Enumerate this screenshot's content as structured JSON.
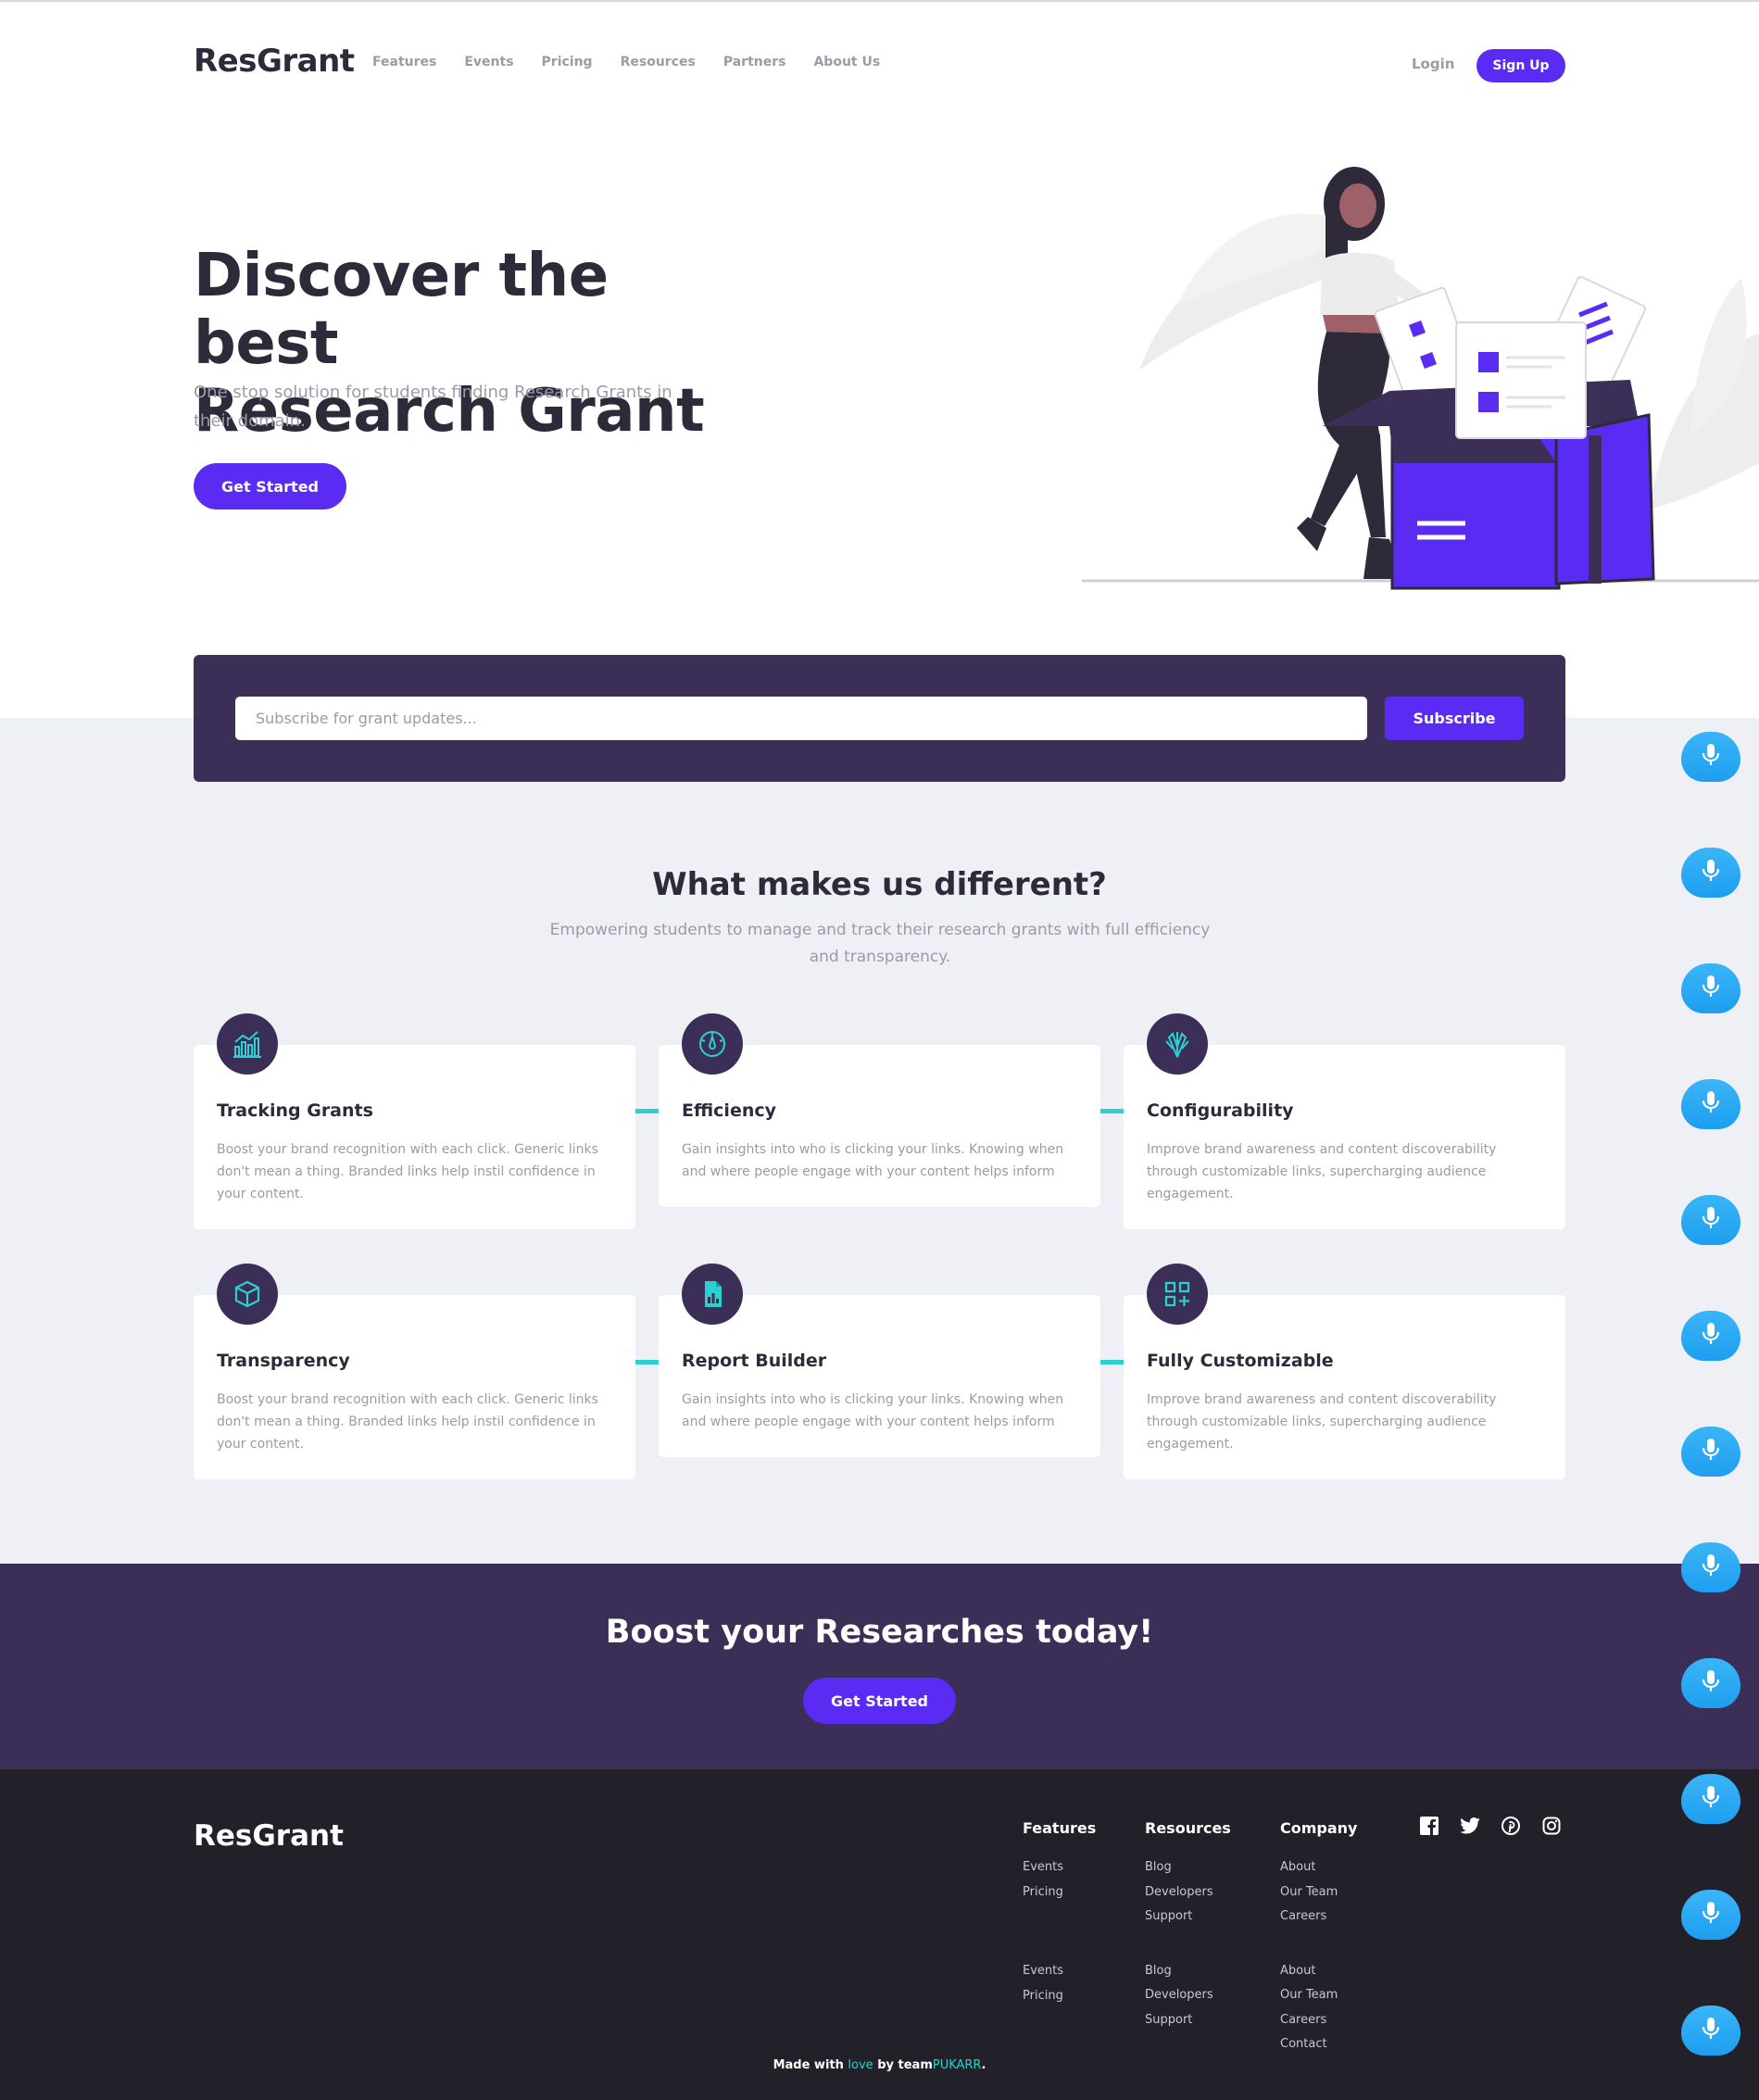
{
  "header": {
    "logo": "ResGrant",
    "nav": [
      "Features",
      "Events",
      "Pricing",
      "Resources",
      "Partners",
      "About Us"
    ],
    "login": "Login",
    "signup": "Sign Up"
  },
  "hero": {
    "title_line1": "Discover the best",
    "title_line2": "Research Grant",
    "subtitle": "One stop solution for students finding Research Grants in their domain.",
    "cta": "Get Started"
  },
  "subscribe": {
    "placeholder": "Subscribe for grant updates...",
    "button": "Subscribe"
  },
  "features": {
    "title": "What makes us different?",
    "subtitle": "Empowering students to manage and track their research grants with full efficiency and transparency.",
    "cards": [
      {
        "title": "Tracking Grants",
        "text": "Boost your brand recognition with each click. Generic links don't mean a thing. Branded links help instil confidence in your content.",
        "icon": "chart-bars-icon"
      },
      {
        "title": "Efficiency",
        "text": "Gain insights into who is clicking your links. Knowing when and where people engage with your content helps inform",
        "icon": "gauge-icon"
      },
      {
        "title": "Configurability",
        "text": "Improve brand awareness and content discoverability through customizable links, supercharging audience engagement.",
        "icon": "tools-icon"
      },
      {
        "title": "Transparency",
        "text": "Boost your brand recognition with each click. Generic links don't mean a thing. Branded links help instil confidence in your content.",
        "icon": "cube-icon"
      },
      {
        "title": "Report Builder",
        "text": "Gain insights into who is clicking your links. Knowing when and where people engage with your content helps inform",
        "icon": "report-file-icon"
      },
      {
        "title": "Fully Customizable",
        "text": "Improve brand awareness and content discoverability through customizable links, supercharging audience engagement.",
        "icon": "grid-add-icon"
      }
    ]
  },
  "cta": {
    "title": "Boost your Researches today!",
    "button": "Get Started"
  },
  "footer": {
    "logo": "ResGrant",
    "columns": [
      {
        "title": "Features",
        "group1": [
          "Events",
          "Pricing"
        ],
        "group2": [
          "Events",
          "Pricing"
        ]
      },
      {
        "title": "Resources",
        "group1": [
          "Blog",
          "Developers",
          "Support"
        ],
        "group2": [
          "Blog",
          "Developers",
          "Support"
        ]
      },
      {
        "title": "Company",
        "group1": [
          "About",
          "Our Team",
          "Careers"
        ],
        "group2": [
          "About",
          "Our Team",
          "Careers",
          "Contact"
        ]
      }
    ],
    "socials": [
      "facebook-icon",
      "twitter-icon",
      "pinterest-icon",
      "instagram-icon"
    ],
    "credit_prefix": "Made with",
    "credit_love": "love",
    "credit_mid": "by team",
    "credit_team": "PUKARR",
    "credit_suffix": "."
  },
  "colors": {
    "primary": "#5a2cf3",
    "dark_purple": "#3b2f57",
    "accent_teal": "#2bd0d0",
    "footer_bg": "#222028",
    "section_bg": "#eff0f5",
    "mic_blue": "#1e9ef0"
  },
  "mic_buttons": {
    "count": 12,
    "icon": "microphone-icon"
  }
}
